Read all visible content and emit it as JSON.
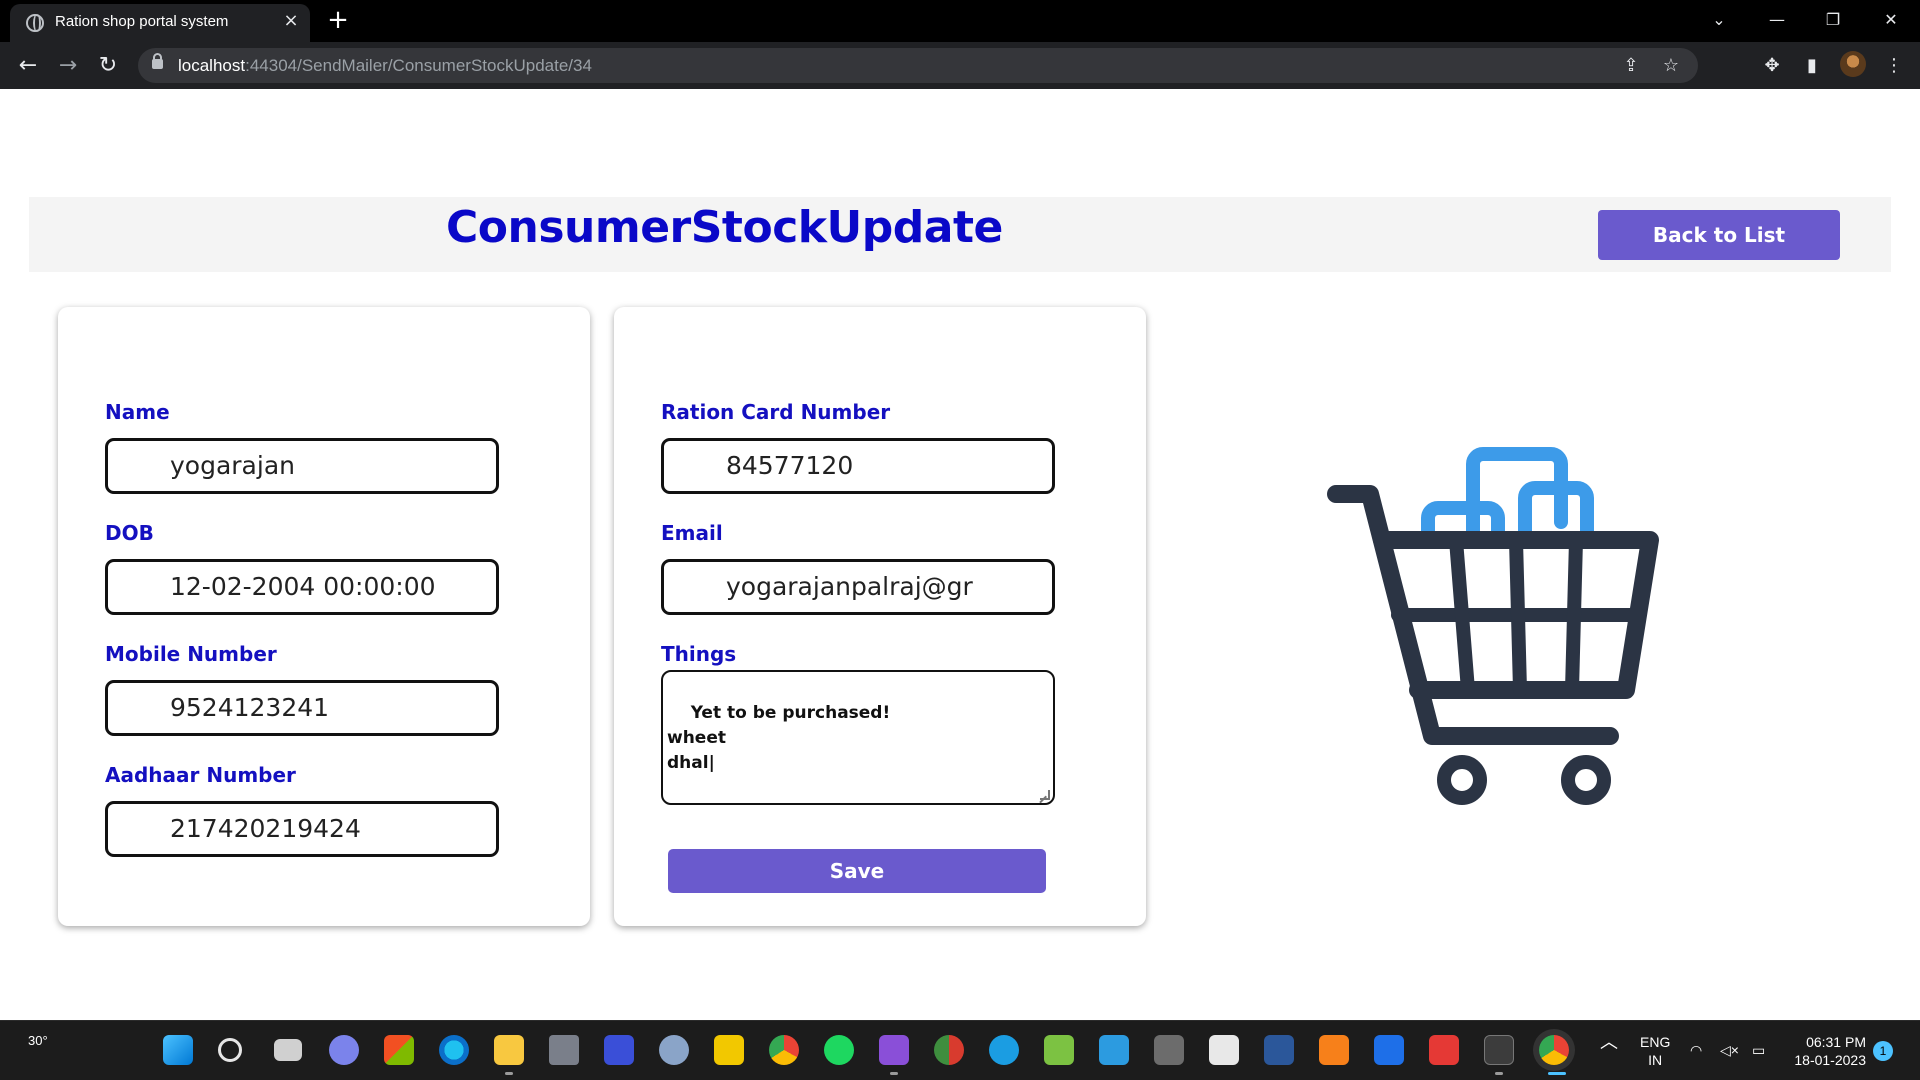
{
  "browser": {
    "tab_title": "Ration shop portal system",
    "tab_close": "×",
    "new_tab": "+",
    "url_host": "localhost",
    "url_rest": ":44304/SendMailer/ConsumerStockUpdate/34"
  },
  "page": {
    "title": "ConsumerStockUpdate",
    "back_button": "Back to List"
  },
  "form_left": {
    "name_label": "Name",
    "name_value": "yogarajan",
    "dob_label": "DOB",
    "dob_value": "12-02-2004 00:00:00",
    "mobile_label": "Mobile Number",
    "mobile_value": "9524123241",
    "aadhaar_label": "Aadhaar Number",
    "aadhaar_value": "217420219424"
  },
  "form_right": {
    "ration_label": "Ration Card Number",
    "ration_value": "84577120",
    "email_label": "Email",
    "email_value": "yogarajanpalraj@gr",
    "things_label": "Things",
    "things_value": "Yet to be purchased!\nwheet\ndhal|",
    "save_button": "Save"
  },
  "taskbar": {
    "weather": "30°",
    "lang_line1": "ENG",
    "lang_line2": "IN",
    "time": "06:31 PM",
    "date": "18-01-2023",
    "notifications": "1"
  },
  "colors": {
    "title_blue": "#0a08c8",
    "label_blue": "#1410c0",
    "button_purple": "#6a5acd",
    "cart_dark": "#2b3444",
    "cart_blue": "#3d9be9"
  }
}
